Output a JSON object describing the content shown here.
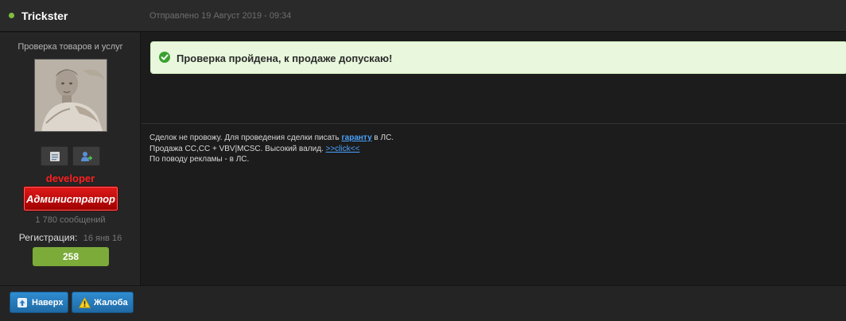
{
  "post": {
    "author": "Trickster",
    "date": "Отправлено 19 Август 2019 - 09:34"
  },
  "user": {
    "title": "Проверка товаров и услуг",
    "group": "developer",
    "role": "Администратор",
    "post_count": "1 780 сообщений",
    "reg_label": "Регистрация:",
    "reg_date": "16 янв 16",
    "reputation": "258"
  },
  "content": {
    "notice": "Проверка пройдена, к продаже допускаю!",
    "signature": {
      "line1_pre": "Сделок не провожу. Для проведения сделки писать ",
      "line1_link": "гаранту",
      "line1_post": " в ЛС.",
      "line2_pre": "Продажа CC,CC + VBV|MCSC. Высокий валид. ",
      "line2_link": ">>click<<",
      "line3": "По поводу рекламы - в ЛС."
    }
  },
  "footer": {
    "up_label": "Наверх",
    "report_label": "Жалоба"
  },
  "icons": {
    "online": "online-dot-icon",
    "pm": "envelope-icon",
    "add_friend": "add-user-icon",
    "success": "check-circle-icon",
    "up": "arrow-up-icon",
    "report": "warning-icon"
  },
  "colors": {
    "background": "#1c1c1c",
    "online": "#7fbf3f",
    "group": "#ff1e1e",
    "reputation": "#7cab3a",
    "notice_bg": "#e9f8dd",
    "link": "#4aa3ff",
    "button": "#2f8cd0"
  }
}
